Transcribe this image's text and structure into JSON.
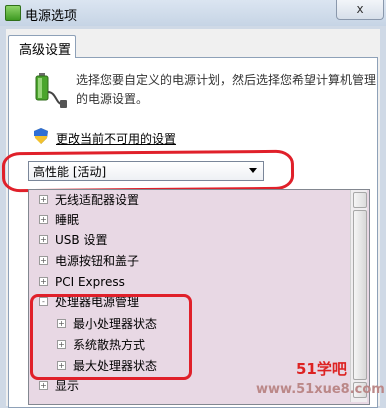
{
  "window": {
    "title": "电源选项",
    "close_label": "x"
  },
  "tab": {
    "label": "高级设置"
  },
  "description": "选择您要自定义的电源计划，然后选择您希望计算机管理的电源设置。",
  "change_link": "更改当前不可用的设置",
  "plan_select": {
    "value": "高性能 [活动]"
  },
  "settings_tree": {
    "items": [
      {
        "label": "无线适配器设置",
        "expander": "+"
      },
      {
        "label": "睡眠",
        "expander": "+"
      },
      {
        "label": "USB 设置",
        "expander": "+"
      },
      {
        "label": "电源按钮和盖子",
        "expander": "+"
      },
      {
        "label": "PCI Express",
        "expander": "+"
      },
      {
        "label": "处理器电源管理",
        "expander": "-"
      },
      {
        "label": "最小处理器状态",
        "expander": "+"
      },
      {
        "label": "系统散热方式",
        "expander": "+"
      },
      {
        "label": "最大处理器状态",
        "expander": "+"
      },
      {
        "label": "显示",
        "expander": "+"
      }
    ]
  },
  "watermark": {
    "line1": "51学吧",
    "line2": "www.51xue8.com"
  },
  "colors": {
    "annotation_red": "#e0202a",
    "tree_background": "#e8d8e4"
  }
}
